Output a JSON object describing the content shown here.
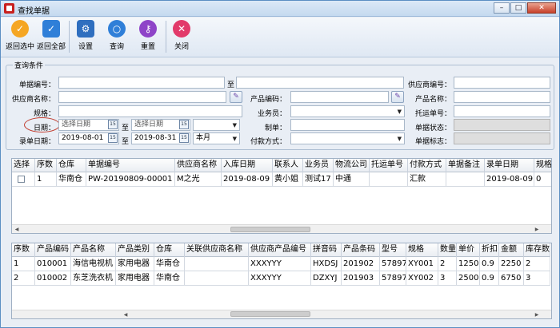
{
  "window": {
    "title": "查找单据",
    "controls": [
      "–",
      "□",
      "✕"
    ]
  },
  "toolbar": [
    {
      "label": "返回选中",
      "icon": "check-circle-icon",
      "color": "#f5a623",
      "glyph": "✓"
    },
    {
      "label": "返回全部",
      "icon": "check-square-icon",
      "color": "#2f7fd8",
      "glyph": "✓"
    },
    {
      "label": "设置",
      "icon": "settings-doc-icon",
      "color": "#2f6fbf",
      "glyph": "⚙"
    },
    {
      "label": "查询",
      "icon": "search-icon",
      "color": "#2f7fd8",
      "glyph": "○"
    },
    {
      "label": "重置",
      "icon": "reset-key-icon",
      "color": "#8e44c8",
      "glyph": "⚷"
    },
    {
      "label": "关闭",
      "icon": "close-circle-icon",
      "color": "#e23a6a",
      "glyph": "✕"
    }
  ],
  "query": {
    "legend": "查询条件",
    "receipt_no": {
      "label": "单据编号：",
      "value": "",
      "to_value": ""
    },
    "range_separator": "至",
    "supplier_no": {
      "label": "供应商编号：",
      "value": ""
    },
    "supplier_name": {
      "label": "供应商名称：",
      "value": ""
    },
    "product_code": {
      "label": "产品编码：",
      "value": ""
    },
    "product_name": {
      "label": "产品名称：",
      "value": ""
    },
    "spec": {
      "label": "规格：",
      "value": ""
    },
    "salesperson": {
      "label": "业务员：",
      "value": ""
    },
    "shipping_no": {
      "label": "托运单号：",
      "value": ""
    },
    "date": {
      "label": "日期：",
      "from_placeholder": "选择日期",
      "to_placeholder": "选择日期",
      "preset": ""
    },
    "maker": {
      "label": "制单：",
      "value": ""
    },
    "receipt_status": {
      "label": "单据状态：",
      "value": ""
    },
    "entry_date": {
      "label": "录单日期：",
      "from": "2019-08-01",
      "to": "2019-08-31",
      "preset": "本月"
    },
    "payment_method": {
      "label": "付款方式：",
      "value": ""
    },
    "receipt_flag": {
      "label": "单据标志：",
      "value": ""
    },
    "calendar_glyph": "15"
  },
  "receipts": {
    "columns": [
      "选择",
      "序数",
      "仓库",
      "单据编号",
      "供应商名称",
      "入库日期",
      "联系人",
      "业务员",
      "物流公司",
      "托运单号",
      "付款方式",
      "单据备注",
      "录单日期",
      "规格"
    ],
    "rows": [
      [
        "",
        "1",
        "华南仓",
        "PW-20190809-00001",
        "M之光",
        "2019-08-09",
        "黄小姐",
        "测试17",
        "中通",
        "",
        "汇款",
        "",
        "2019-08-09",
        "0"
      ]
    ]
  },
  "details": {
    "columns": [
      "序数",
      "产品编码",
      "产品名称",
      "产品类别",
      "仓库",
      "关联供应商名称",
      "供应商产品编号",
      "拼音码",
      "产品条码",
      "型号",
      "规格",
      "数量",
      "单价",
      "折扣",
      "金额",
      "库存数"
    ],
    "rows": [
      [
        "1",
        "010001",
        "海信电视机",
        "家用电器",
        "华南仓",
        "",
        "XXXYYY",
        "HXDSJ",
        "201902",
        "57897",
        "XY001",
        "2",
        "1250",
        "0.9",
        "2250",
        "2"
      ],
      [
        "2",
        "010002",
        "东芝洗衣机",
        "家用电器",
        "华南仓",
        "",
        "XXXYYY",
        "DZXYJ",
        "201903",
        "57897",
        "XY002",
        "3",
        "2500",
        "0.9",
        "6750",
        "3"
      ]
    ]
  }
}
